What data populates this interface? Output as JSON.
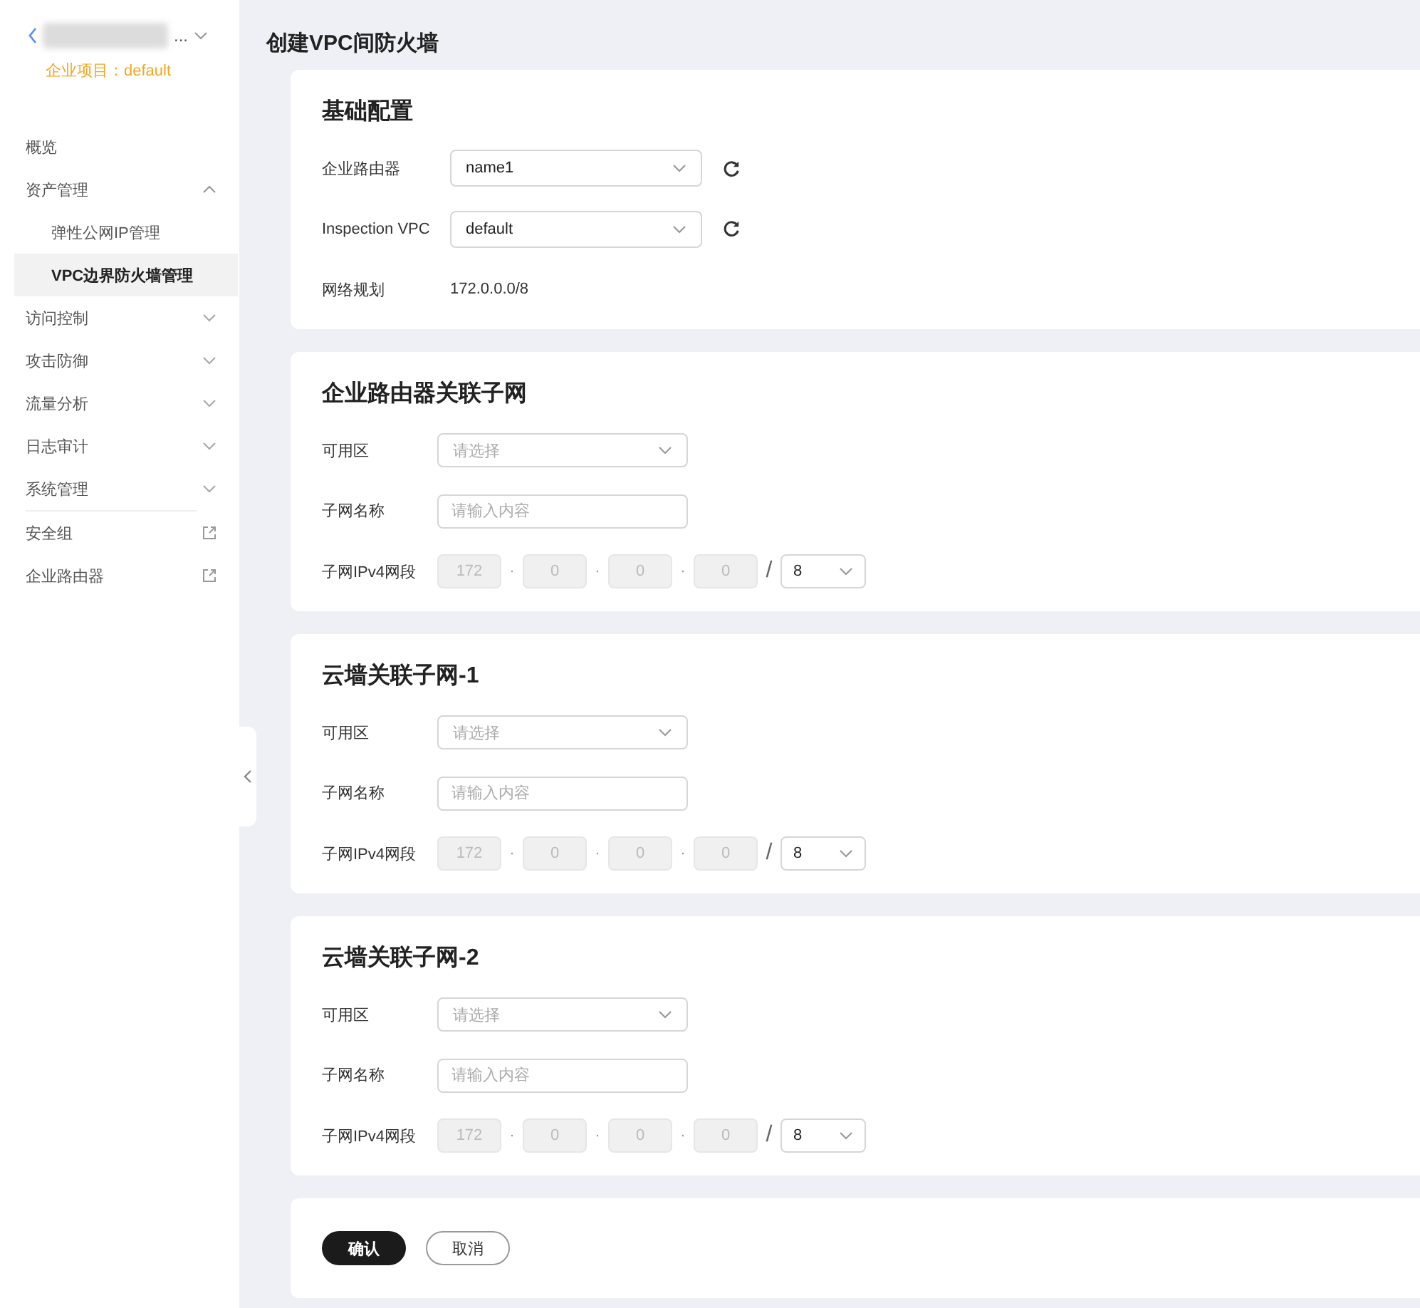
{
  "sidebar": {
    "title_suffix": "...",
    "project_label": "企业项目：default",
    "items": [
      {
        "label": "概览",
        "kind": "item",
        "selected": false
      },
      {
        "label": "资产管理",
        "kind": "group",
        "expanded": true,
        "selected": false,
        "children": [
          {
            "label": "弹性公网IP管理",
            "selected": false
          },
          {
            "label": "VPC边界防火墙管理",
            "selected": true
          }
        ]
      },
      {
        "label": "访问控制",
        "kind": "group",
        "expanded": false,
        "selected": false
      },
      {
        "label": "攻击防御",
        "kind": "group",
        "expanded": false,
        "selected": false
      },
      {
        "label": "流量分析",
        "kind": "group",
        "expanded": false,
        "selected": false
      },
      {
        "label": "日志审计",
        "kind": "group",
        "expanded": false,
        "selected": false
      },
      {
        "label": "系统管理",
        "kind": "group",
        "expanded": false,
        "selected": false
      },
      {
        "label": "安全组",
        "kind": "link",
        "selected": false
      },
      {
        "label": "企业路由器",
        "kind": "link",
        "selected": false
      }
    ]
  },
  "page_title": "创建VPC间防火墙",
  "sections": [
    {
      "title": "基础配置",
      "fields": [
        {
          "kind": "select",
          "label": "企业路由器",
          "value": "name1",
          "refresh": true
        },
        {
          "kind": "select",
          "label": "Inspection VPC",
          "value": "default",
          "refresh": true
        },
        {
          "kind": "text",
          "label": "网络规划",
          "value": "172.0.0.0/8"
        }
      ]
    },
    {
      "title": "企业路由器关联子网",
      "fields": [
        {
          "kind": "select",
          "label": "可用区",
          "placeholder": "请选择",
          "refresh": false
        },
        {
          "kind": "input",
          "label": "子网名称",
          "placeholder": "请输入内容"
        },
        {
          "kind": "ip",
          "label": "子网IPv4网段",
          "octets": [
            "172",
            "0",
            "0",
            "0"
          ],
          "disabled": true,
          "octet_separator": "·",
          "prefix_separator": "/",
          "prefix": "8"
        }
      ]
    },
    {
      "title": "云墙关联子网-1",
      "fields": [
        {
          "kind": "select",
          "label": "可用区",
          "placeholder": "请选择",
          "refresh": false
        },
        {
          "kind": "input",
          "label": "子网名称",
          "placeholder": "请输入内容"
        },
        {
          "kind": "ip",
          "label": "子网IPv4网段",
          "octets": [
            "172",
            "0",
            "0",
            "0"
          ],
          "disabled": true,
          "octet_separator": "·",
          "prefix_separator": "/",
          "prefix": "8"
        }
      ]
    },
    {
      "title": "云墙关联子网-2",
      "fields": [
        {
          "kind": "select",
          "label": "可用区",
          "placeholder": "请选择",
          "refresh": false
        },
        {
          "kind": "input",
          "label": "子网名称",
          "placeholder": "请输入内容"
        },
        {
          "kind": "ip",
          "label": "子网IPv4网段",
          "octets": [
            "172",
            "0",
            "0",
            "0"
          ],
          "disabled": true,
          "octet_separator": "·",
          "prefix_separator": "/",
          "prefix": "8"
        }
      ]
    }
  ],
  "buttons": [
    {
      "label": "确认",
      "kind": "primary"
    },
    {
      "label": "取消",
      "kind": "secondary"
    }
  ]
}
